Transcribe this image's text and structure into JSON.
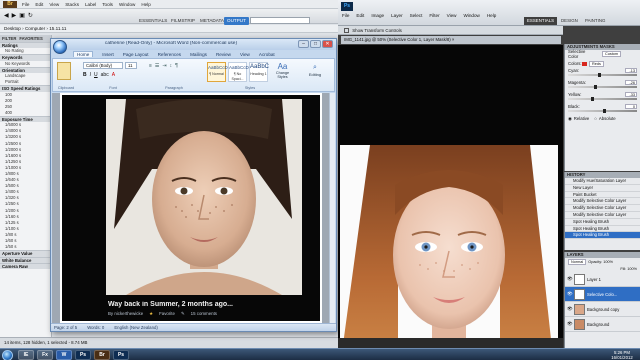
{
  "bridge": {
    "menu": [
      "File",
      "Edit",
      "View",
      "Stacks",
      "Label",
      "Tools",
      "Window",
      "Help"
    ],
    "workspaces": [
      "ESSENTIALS",
      "FILMSTRIP",
      "METADATA",
      "OUTPUT"
    ],
    "path": [
      "Desktop",
      "Computer",
      "15.11.11"
    ],
    "filter_tabs": [
      "FILTER",
      "FAVORITES"
    ],
    "filter_sections": [
      {
        "title": "Ratings",
        "items": [
          "No Rating"
        ]
      },
      {
        "title": "Keywords",
        "items": [
          "No Keywords"
        ]
      },
      {
        "title": "Orientation",
        "items": [
          "Landscape",
          "Portrait"
        ]
      },
      {
        "title": "ISO Speed Ratings",
        "items": [
          "100",
          "200",
          "250",
          "400"
        ]
      },
      {
        "title": "Exposure Time",
        "items": [
          "1/5000 s",
          "1/4000 s",
          "1/3200 s",
          "1/2500 s",
          "1/2000 s",
          "1/1600 s",
          "1/1250 s",
          "1/1000 s",
          "1/800 s",
          "1/640 s",
          "1/500 s",
          "1/400 s",
          "1/320 s",
          "1/250 s",
          "1/200 s",
          "1/160 s",
          "1/125 s",
          "1/100 s",
          "1/80 s",
          "1/60 s",
          "1/50 s"
        ]
      },
      {
        "title": "Aperture Value",
        "items": []
      },
      {
        "title": "White Balance",
        "items": []
      },
      {
        "title": "Camera Raw",
        "items": []
      }
    ],
    "status": "14 items, 128 hidden, 1 selected - 8.74 MB"
  },
  "word": {
    "title": "catherine (Read-Only) - Microsoft Word (Non-commercial use)",
    "tabs": [
      "Home",
      "Insert",
      "Page Layout",
      "References",
      "Mailings",
      "Review",
      "View",
      "Acrobat"
    ],
    "font_name": "Calibri (Body)",
    "font_size": "11",
    "styles": [
      {
        "sample": "AaBbCcDc",
        "name": "¶ Normal"
      },
      {
        "sample": "AaBbCcDc",
        "name": "¶ No Spaci..."
      },
      {
        "sample": "AaBbC",
        "name": "Heading 1"
      }
    ],
    "change_styles": "Change Styles",
    "editing": "Editing",
    "groups": [
      "Clipboard",
      "Font",
      "Paragraph",
      "Styles"
    ],
    "caption": "Way back in Summer, 2 months ago...",
    "meta": {
      "by": "By nickerthewicke",
      "favorite": "Favorite",
      "comments": "15 comments"
    },
    "status": [
      "Page: 2 of 5",
      "Words: 0",
      "English (New Zealand)"
    ]
  },
  "photoshop": {
    "menu": [
      "File",
      "Edit",
      "Image",
      "Layer",
      "Select",
      "Filter",
      "View",
      "Window",
      "Help"
    ],
    "workspaces": [
      "ESSENTIALS",
      "DESIGN",
      "PAINTING"
    ],
    "options": "Show Transform Controls",
    "doc_tab": "IMG_1141.jpg @ 50% (Selective Color 1, Layer Mask/8) ×",
    "adjustments": {
      "title": "ADJUSTMENTS  MASKS",
      "label": "Selective Color",
      "preset": "Custom",
      "colors_label": "Colors:",
      "colors_value": "Reds",
      "sliders": [
        {
          "name": "Cyan:",
          "value": "-13",
          "pct": 0.44
        },
        {
          "name": "Magenta:",
          "value": "-26",
          "pct": 0.37
        },
        {
          "name": "Yellow:",
          "value": "-33",
          "pct": 0.33
        },
        {
          "name": "Black:",
          "value": "0",
          "pct": 0.5
        }
      ],
      "method": [
        "Relative",
        "Absolute"
      ]
    },
    "history": {
      "title": "HISTORY",
      "items": [
        "Modify Hue/Saturation Layer",
        "New Layer",
        "Paint Bucket",
        "Modify Selective Color Layer",
        "Modify Selective Color Layer",
        "Modify Selective Color Layer",
        "Spot Healing Brush",
        "Spot Healing Brush",
        "Spot Healing Brush"
      ],
      "selected": 8
    },
    "layers": {
      "title": "LAYERS",
      "blend": "Normal",
      "opacity": "Opacity: 100%",
      "fill": "Fill: 100%",
      "items": [
        "Layer 1",
        "Selective Colo...",
        "Background copy",
        "Background"
      ],
      "selected": 1
    }
  },
  "taskbar": {
    "apps": [
      "IE",
      "Fx",
      "W",
      "Ps",
      "Br",
      "Ps"
    ],
    "time": "5:26 PM",
    "date": "16/01/2012"
  }
}
